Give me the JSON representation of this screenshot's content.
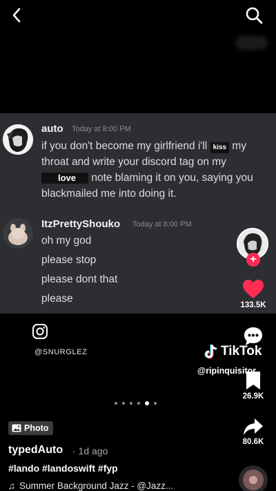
{
  "messages": [
    {
      "username": "auto",
      "timestamp": "Today at 8:00 PM",
      "text_a": "if you don't become my girlfriend i'll ",
      "redact_1": "kiss",
      "text_b": " my throat and write your discord tag on my ",
      "redact_2": "love",
      "text_c": " note blaming it on you, saying you blackmailed me into doing it."
    },
    {
      "username": "ItzPrettyShouko",
      "timestamp": "Today at 8:00 PM",
      "lines": [
        "oh my god",
        "please stop",
        "please dont that",
        "please"
      ]
    }
  ],
  "social": {
    "handle": "@SNURGLEZ",
    "icon": "instagram-icon"
  },
  "watermark": {
    "brand": "TikTok",
    "user": "@ripinquisitor_"
  },
  "rail": {
    "likes": "133.5K",
    "saves": "26.9K",
    "shares": "80.6K",
    "follow": "+"
  },
  "carousel": {
    "count": 6,
    "active_index": 4
  },
  "post": {
    "badge": "Photo",
    "author": "typedAuto",
    "posted": "· 1d ago",
    "hashtags": "#lando #landoswift #fyp",
    "music": "Summer Background Jazz - @Jazz..."
  },
  "colors": {
    "like": "#fe2c55",
    "panel": "#2d2e32",
    "background": "#000000"
  }
}
